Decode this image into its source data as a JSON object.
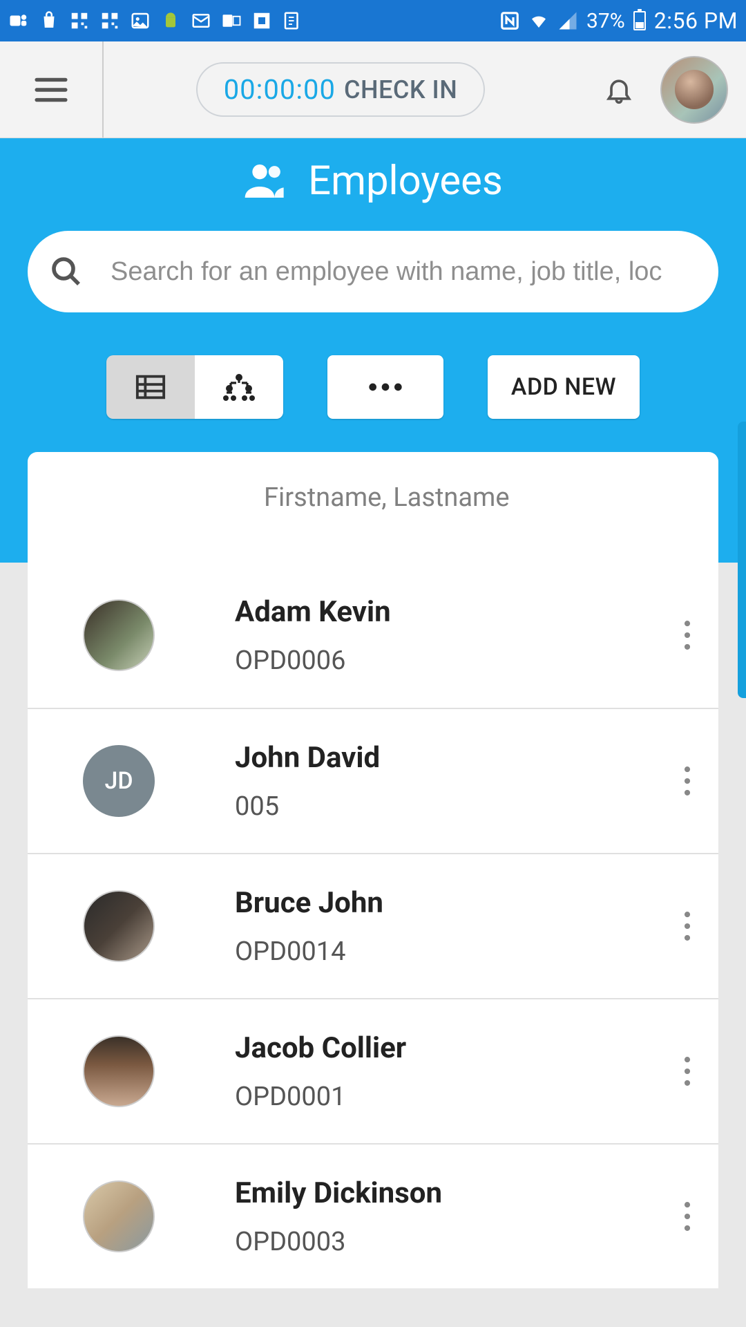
{
  "status": {
    "battery": "37%",
    "time": "2:56 PM"
  },
  "header": {
    "timer": "00:00:00",
    "checkin_label": "CHECK IN"
  },
  "page": {
    "title": "Employees"
  },
  "search": {
    "placeholder": "Search for an employee with name, job title, loc"
  },
  "toolbar": {
    "add_new_label": "ADD NEW"
  },
  "list": {
    "header_label": "Firstname, Lastname",
    "employees": [
      {
        "name": "Adam Kevin",
        "code": "OPD0006",
        "avatar_type": "img1"
      },
      {
        "name": "John David",
        "code": "005",
        "avatar_type": "initials",
        "initials": "JD"
      },
      {
        "name": "Bruce John",
        "code": "OPD0014",
        "avatar_type": "img3"
      },
      {
        "name": "Jacob Collier",
        "code": "OPD0001",
        "avatar_type": "img4"
      },
      {
        "name": "Emily Dickinson",
        "code": "OPD0003",
        "avatar_type": "img5"
      }
    ]
  }
}
